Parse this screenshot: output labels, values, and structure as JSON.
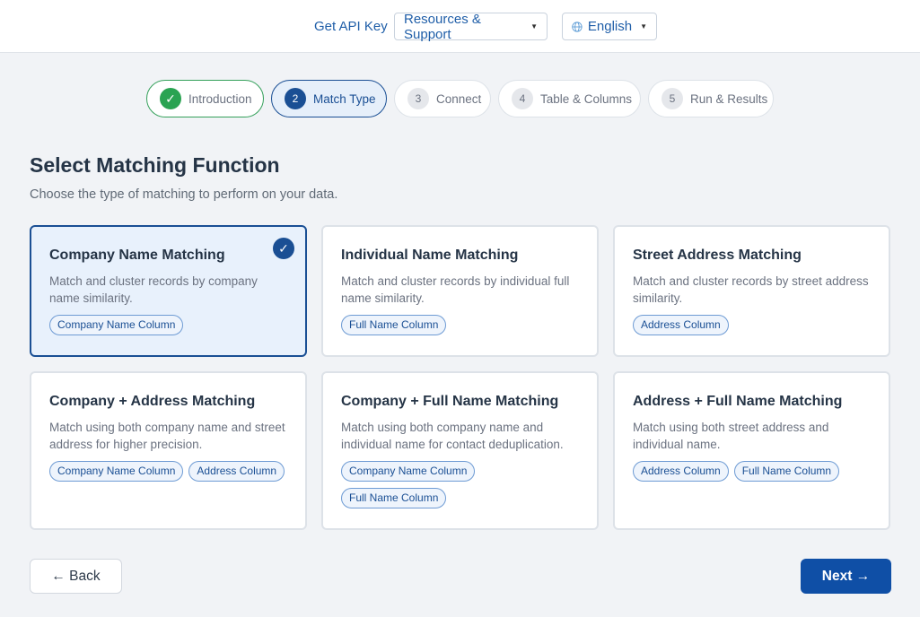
{
  "header": {
    "api_key_label": "Get API Key",
    "resources_label": "Resources & Support",
    "language_label": "English"
  },
  "steps": [
    {
      "num": "✓",
      "label": "Introduction",
      "state": "done"
    },
    {
      "num": "2",
      "label": "Match Type",
      "state": "active"
    },
    {
      "num": "3",
      "label": "Connect",
      "state": "pending"
    },
    {
      "num": "4",
      "label": "Table & Columns",
      "state": "pending"
    },
    {
      "num": "5",
      "label": "Run & Results",
      "state": "pending"
    }
  ],
  "page": {
    "title": "Select Matching Function",
    "subtitle": "Choose the type of matching to perform on your data."
  },
  "cards": [
    {
      "title": "Company Name Matching",
      "desc": "Match and cluster records by company name similarity.",
      "tags": [
        "Company Name Column"
      ],
      "selected": true
    },
    {
      "title": "Individual Name Matching",
      "desc": "Match and cluster records by individual full name similarity.",
      "tags": [
        "Full Name Column"
      ],
      "selected": false
    },
    {
      "title": "Street Address Matching",
      "desc": "Match and cluster records by street address similarity.",
      "tags": [
        "Address Column"
      ],
      "selected": false
    },
    {
      "title": "Company + Address Matching",
      "desc": "Match using both company name and street address for higher precision.",
      "tags": [
        "Company Name Column",
        "Address Column"
      ],
      "selected": false
    },
    {
      "title": "Company + Full Name Matching",
      "desc": "Match using both company name and individual name for contact deduplication.",
      "tags": [
        "Company Name Column",
        "Full Name Column"
      ],
      "selected": false
    },
    {
      "title": "Address + Full Name Matching",
      "desc": "Match using both street address and individual name.",
      "tags": [
        "Address Column",
        "Full Name Column"
      ],
      "selected": false
    }
  ],
  "footer": {
    "back_label": "← Back",
    "next_label": "Next →"
  },
  "colors": {
    "primary": "#0f4fa6",
    "success": "#2aa352",
    "selected_bg": "#e8f1fc"
  }
}
